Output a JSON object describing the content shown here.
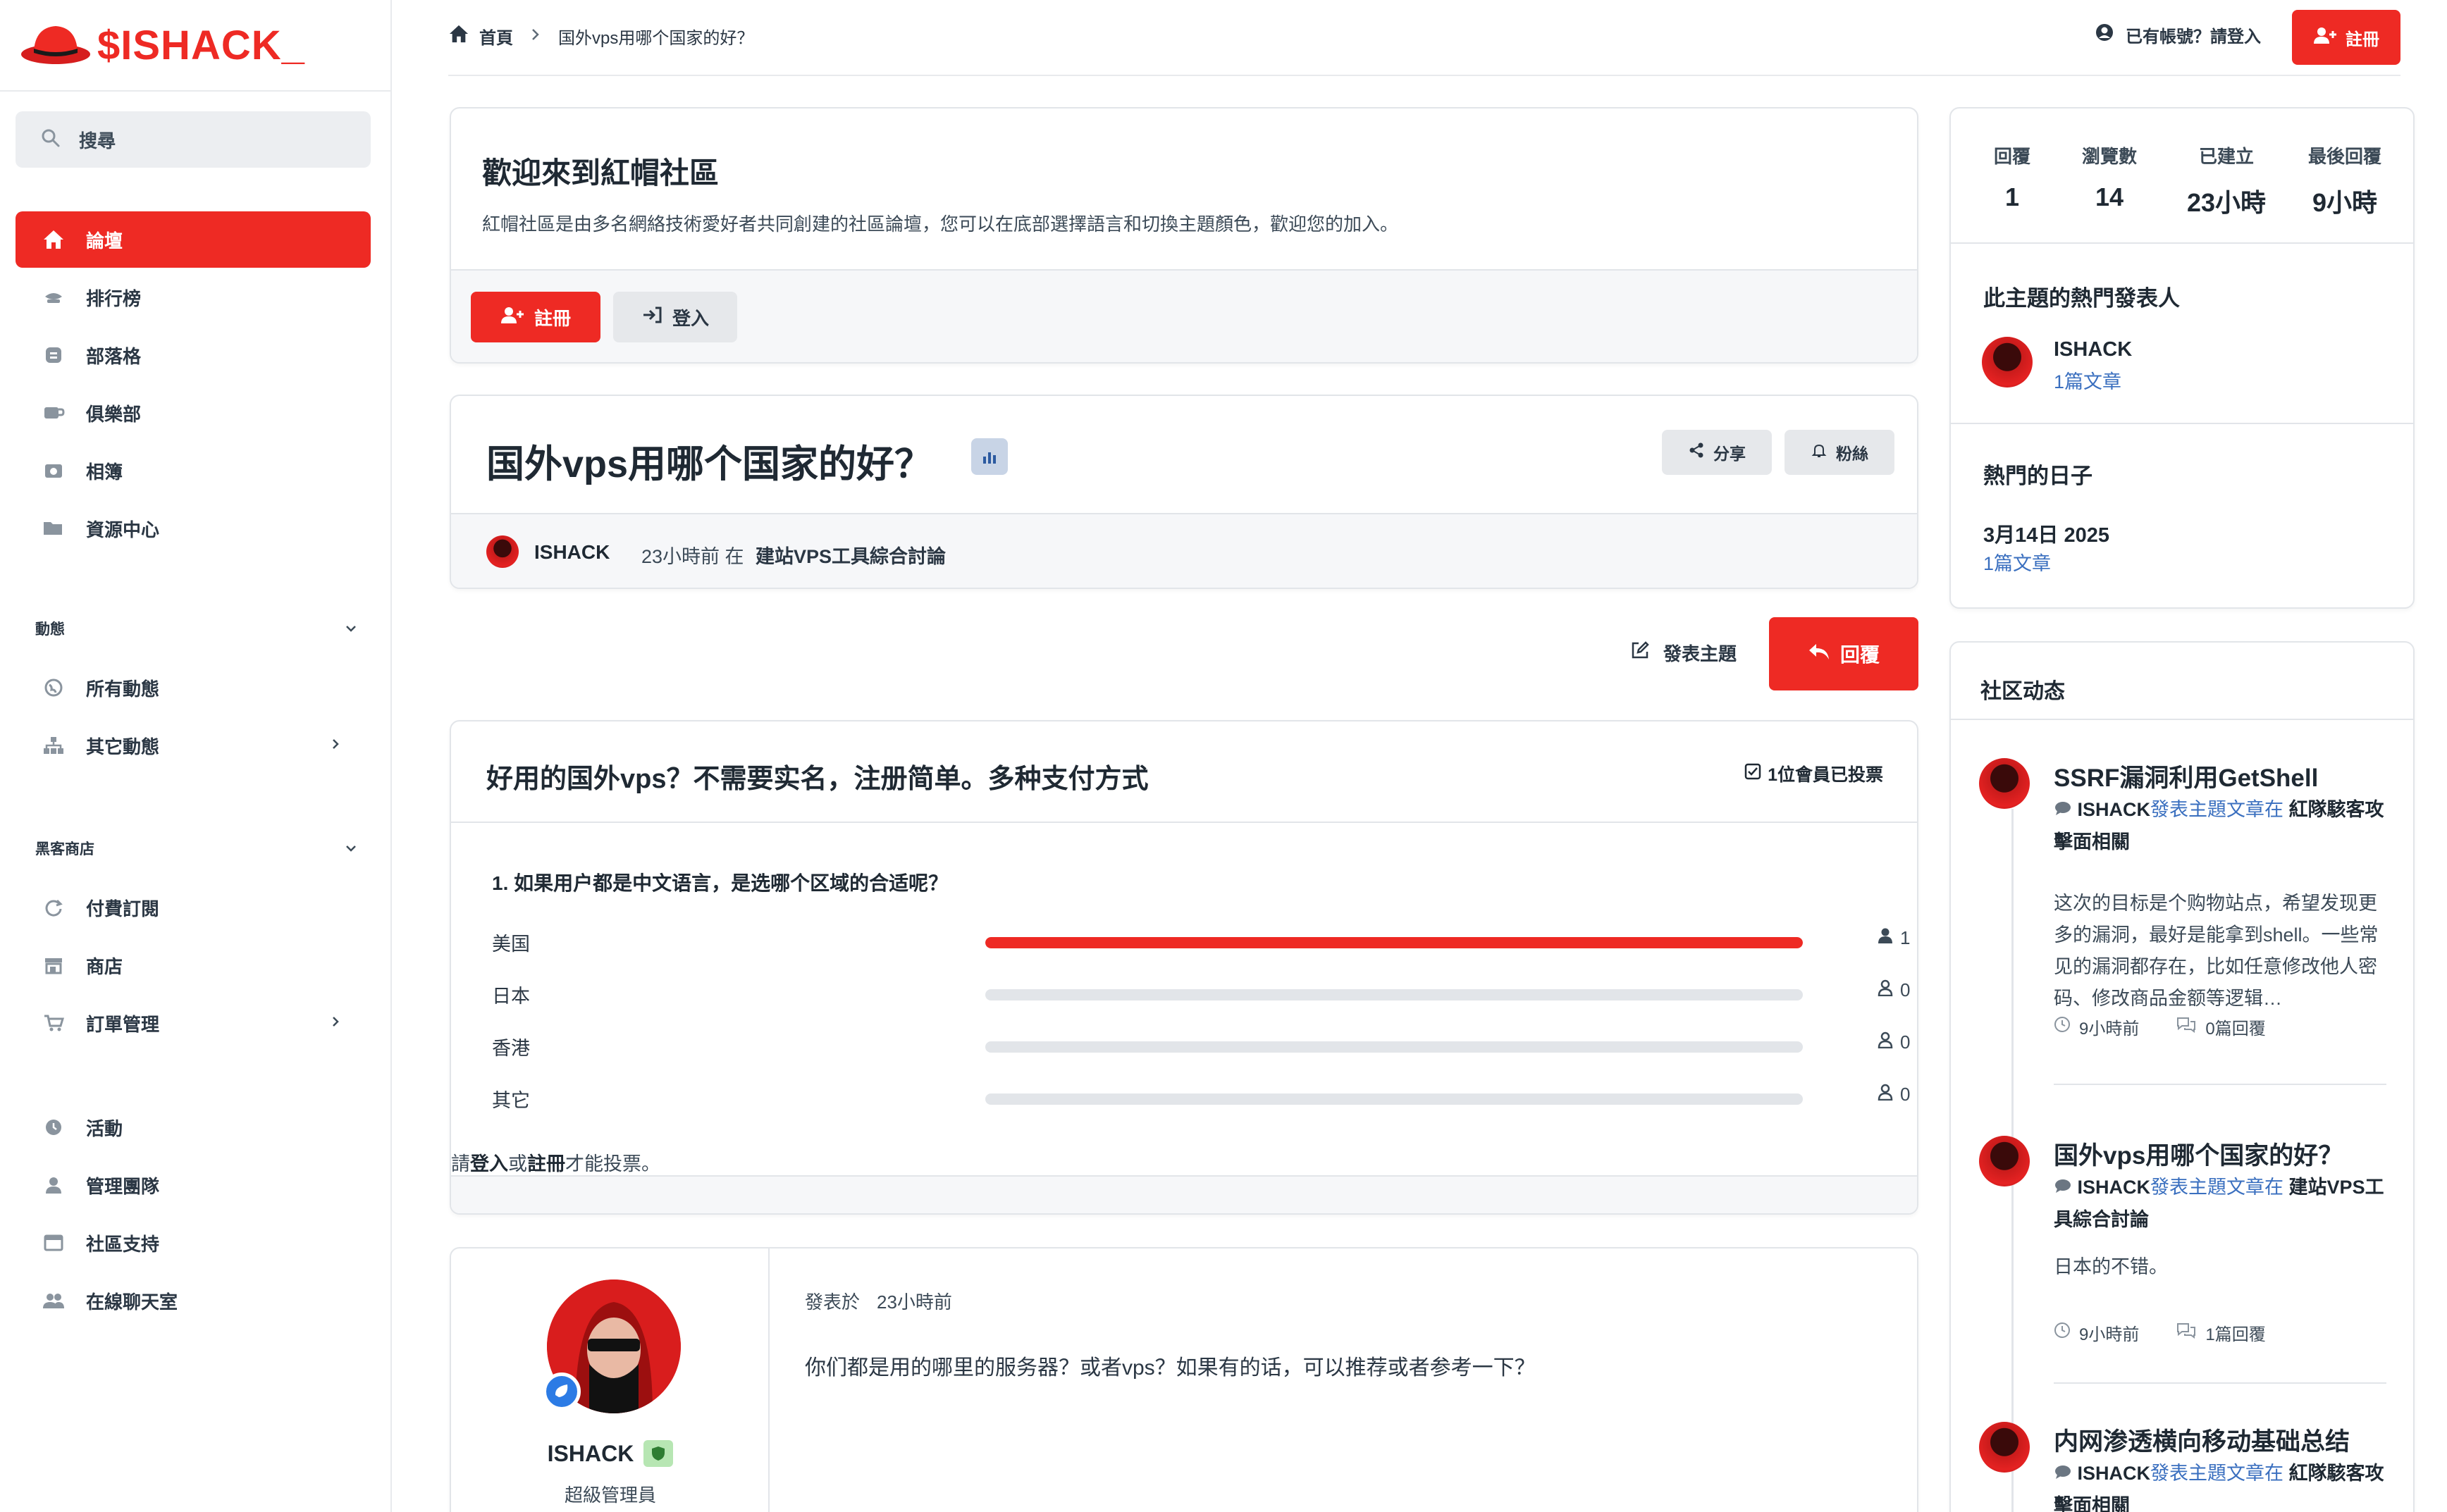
{
  "brand": {
    "name": "$ISHACK_",
    "accent": "#ee2a24"
  },
  "sidebar": {
    "search_label": "搜尋",
    "main_items": [
      {
        "label": "論壇",
        "icon": "home-icon",
        "active": true
      },
      {
        "label": "排行榜",
        "icon": "trophy-icon"
      },
      {
        "label": "部落格",
        "icon": "blog-icon"
      },
      {
        "label": "俱樂部",
        "icon": "coffee-icon"
      },
      {
        "label": "相簿",
        "icon": "camera-icon"
      },
      {
        "label": "資源中心",
        "icon": "folder-icon"
      }
    ],
    "activity_section": "動態",
    "activity_items": [
      {
        "label": "所有動態",
        "icon": "globe-icon"
      },
      {
        "label": "其它動態",
        "icon": "sitemap-icon"
      }
    ],
    "shop_section": "黑客商店",
    "shop_items": [
      {
        "label": "付費訂閱",
        "icon": "refresh-icon"
      },
      {
        "label": "商店",
        "icon": "store-icon"
      },
      {
        "label": "訂單管理",
        "icon": "cart-icon"
      }
    ],
    "other_items": [
      {
        "label": "活動",
        "icon": "clock-icon"
      },
      {
        "label": "管理團隊",
        "icon": "user-tie-icon"
      },
      {
        "label": "社區支持",
        "icon": "window-icon"
      },
      {
        "label": "在線聊天室",
        "icon": "users-icon"
      }
    ]
  },
  "topbar": {
    "home": "首頁",
    "crumb": "国外vps用哪个国家的好？",
    "login_hint": "已有帳號？請登入",
    "register": "註冊"
  },
  "welcome": {
    "title": "歡迎來到紅帽社區",
    "desc": "紅帽社區是由多名網絡技術愛好者共同創建的社區論壇，您可以在底部選擇語言和切換主題顏色，歡迎您的加入。",
    "register": "註冊",
    "login": "登入"
  },
  "topic": {
    "title": "国外vps用哪个国家的好？",
    "share": "分享",
    "follow": "粉絲",
    "author": "ISHACK",
    "meta_time": "23小時前 在",
    "forum": "建站VPS工具綜合討論"
  },
  "actions": {
    "new_topic": "發表主題",
    "reply": "回覆"
  },
  "poll": {
    "title": "好用的国外vps？不需要实名，注册简单。多种支付方式",
    "voted": "1位會員已投票",
    "question": "1. 如果用户都是中文语言，是选哪个区域的合适呢？",
    "options": [
      {
        "name": "美国",
        "votes": 1,
        "share": 1.0
      },
      {
        "name": "日本",
        "votes": 0,
        "share": 0
      },
      {
        "name": "香港",
        "votes": 0,
        "share": 0
      },
      {
        "name": "其它",
        "votes": 0,
        "share": 0
      }
    ],
    "note_pre": "請",
    "note_login": "登入",
    "note_mid": "或",
    "note_register": "註冊",
    "note_post": "才能投票。"
  },
  "post": {
    "author": "ISHACK",
    "role": "超級管理員",
    "posted_label": "發表於",
    "posted_time": "23小時前",
    "body": "你们都是用的哪里的服务器？或者vps？如果有的话，可以推荐或者参考一下？"
  },
  "stats": {
    "items": [
      {
        "k": "回覆",
        "v": "1"
      },
      {
        "k": "瀏覽數",
        "v": "14"
      },
      {
        "k": "已建立",
        "v": "23小時"
      },
      {
        "k": "最後回覆",
        "v": "9小時"
      }
    ],
    "top_posters_title": "此主題的熱門發表人",
    "poster_name": "ISHACK",
    "poster_count": "1篇文章",
    "popular_days_title": "熱門的日子",
    "day": "3月14日 2025",
    "day_count": "1篇文章"
  },
  "activity": {
    "title": "社区动态",
    "items": [
      {
        "title": "SSRF漏洞利用GetShell",
        "user": "ISHACK",
        "verb": "發表主題文章在",
        "forum": "紅隊駭客攻擊面相關",
        "excerpt": "这次的目标是个购物站点，希望发现更多的漏洞，最好是能拿到shell。一些常见的漏洞都存在，比如任意修改他人密码、修改商品金额等逻辑…",
        "time": "9小時前",
        "replies": "0篇回覆"
      },
      {
        "title": "国外vps用哪个国家的好？",
        "user": "ISHACK",
        "verb": "發表主題文章在",
        "forum": "建站VPS工具綜合討論",
        "excerpt": "日本的不错。",
        "time": "9小時前",
        "replies": "1篇回覆"
      },
      {
        "title": "内网渗透横向移动基础总结",
        "user": "ISHACK",
        "verb": "發表主題文章在",
        "forum": "紅隊駭客攻擊面相關"
      }
    ]
  }
}
